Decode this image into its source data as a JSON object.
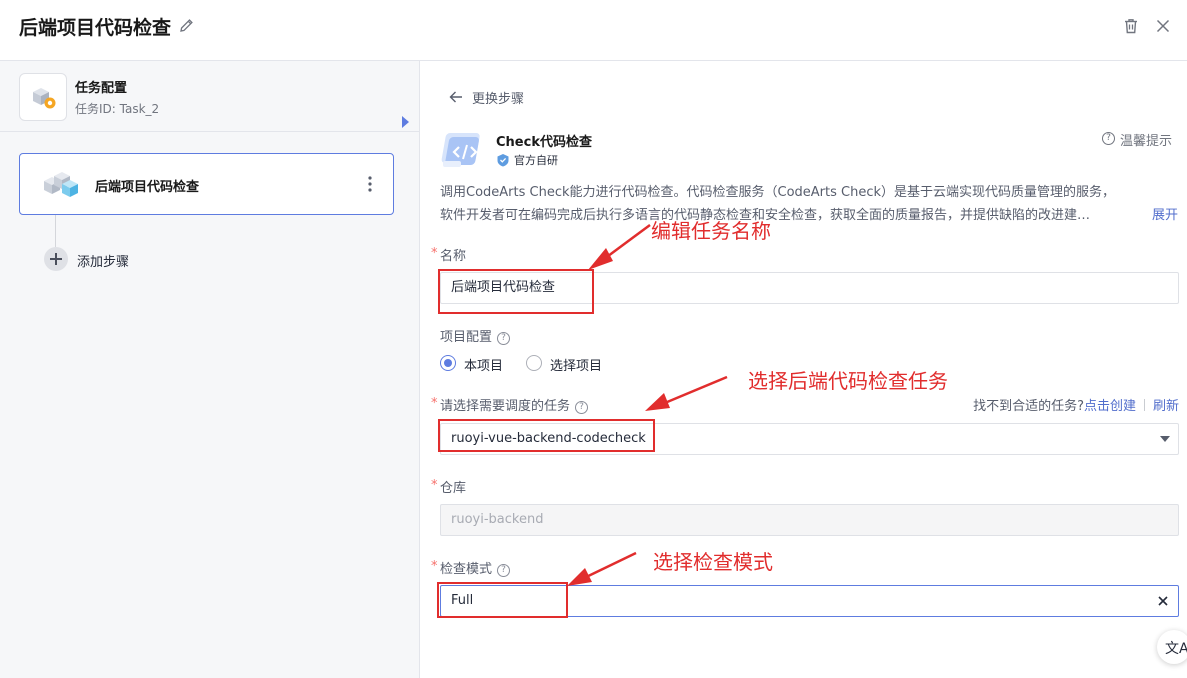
{
  "header": {
    "title": "后端项目代码检查"
  },
  "left": {
    "task_title": "任务配置",
    "task_id": "任务ID: Task_2",
    "step_label": "后端项目代码检查",
    "add_step": "添加步骤"
  },
  "right": {
    "back_label": "更换步骤",
    "plugin_name": "Check代码检查",
    "official_label": "官方自研",
    "tips_label": "温馨提示",
    "desc_line1": "调用CodeArts Check能力进行代码检查。代码检查服务（CodeArts Check）是基于云端实现代码质量管理的服务，",
    "desc_line2": "软件开发者可在编码完成后执行多语言的代码静态检查和安全检查，获取全面的质量报告，并提供缺陷的改进建…",
    "expand": "展开",
    "name_label": "名称",
    "name_value": "后端项目代码检查",
    "project_label": "项目配置",
    "radio_this": "本项目",
    "radio_select": "选择项目",
    "task_select_label": "请选择需要调度的任务",
    "hint_text": "找不到合适的任务?",
    "hint_create": "点击创建",
    "hint_refresh": "刷新",
    "task_value": "ruoyi-vue-backend-codecheck",
    "repo_label": "仓库",
    "repo_value": "ruoyi-backend",
    "mode_label": "检查模式",
    "mode_value": "Full",
    "translate_glyph": "文A"
  },
  "annotations": {
    "edit_name": "编辑任务名称",
    "select_task": "选择后端代码检查任务",
    "select_mode": "选择检查模式"
  },
  "colors": {
    "accent": "#5e7ce0",
    "link": "#526ecc",
    "annotation": "#e12d2d",
    "required": "#f66f6a"
  }
}
